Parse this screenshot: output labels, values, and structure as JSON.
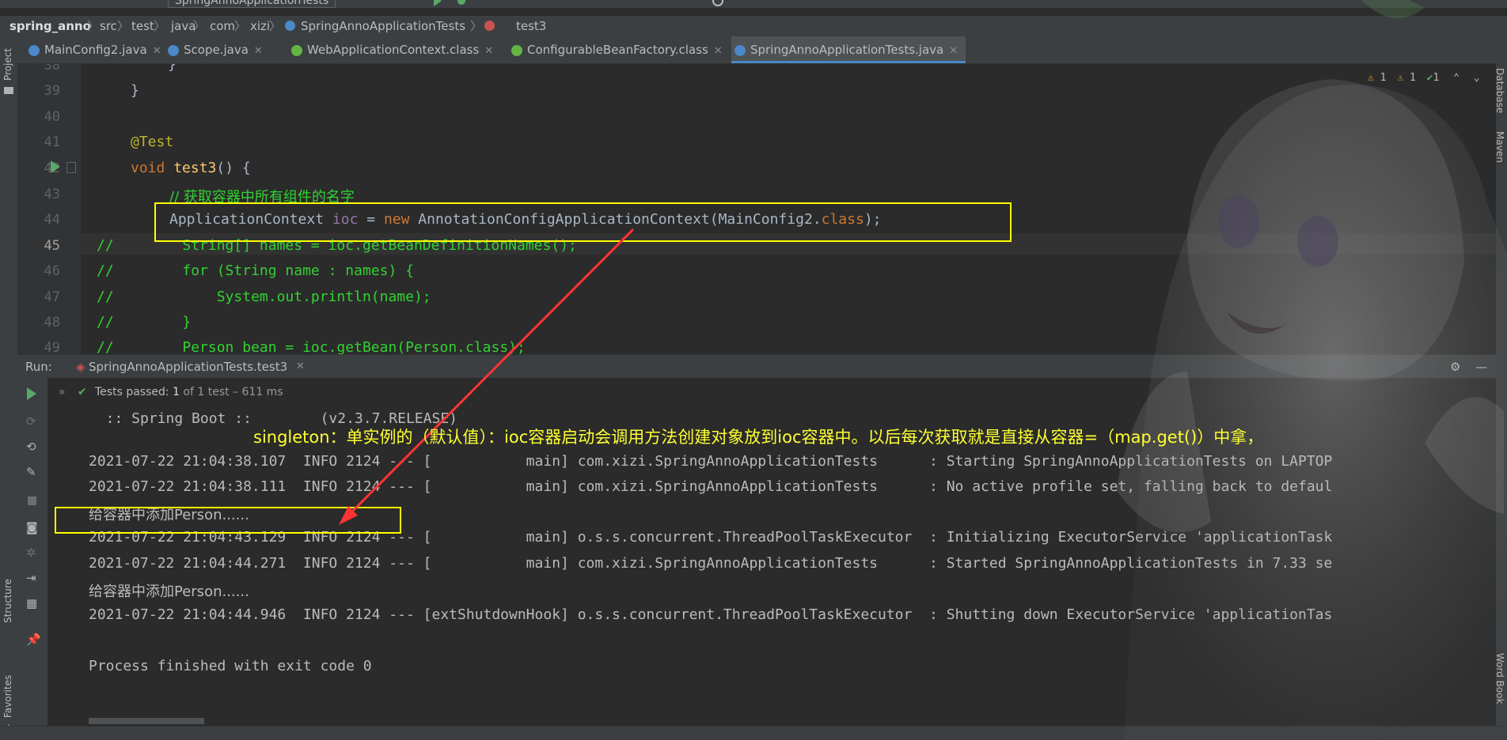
{
  "toolbar": {
    "run_config": "SpringAnnoApplicationTests"
  },
  "breadcrumb": {
    "items": [
      "spring_anno",
      "src",
      "test",
      "java",
      "com",
      "xizi",
      "SpringAnnoApplicationTests",
      "test3"
    ]
  },
  "left_tools": {
    "project": "Project",
    "structure": "Structure",
    "favorites": "Favorites"
  },
  "right_tools": {
    "database": "Database",
    "maven": "Maven",
    "word_book": "Word Book"
  },
  "tabs": [
    {
      "label": "MainConfig2.java",
      "color": "#4a88c7"
    },
    {
      "label": "Scope.java",
      "color": "#4a88c7"
    },
    {
      "label": "WebApplicationContext.class",
      "color": "#62b543"
    },
    {
      "label": "ConfigurableBeanFactory.class",
      "color": "#62b543"
    },
    {
      "label": "SpringAnnoApplicationTests.java",
      "color": "#4a88c7"
    }
  ],
  "inspections": {
    "warn1": "1",
    "warn2": "1",
    "ok": "1"
  },
  "editor": {
    "line_numbers": [
      "38",
      "39",
      "40",
      "41",
      "42",
      "43",
      "44",
      "45",
      "46",
      "47",
      "48",
      "49"
    ],
    "lines": {
      "l38": "}",
      "l39": "}",
      "l41_ann": "@Test",
      "l42_kw": "void",
      "l42_fn": "test3",
      "l42_rest": "() {",
      "l43": "// 获取容器中所有组件的名字",
      "l44_a": "ApplicationContext ",
      "l44_var": "ioc",
      "l44_b": " = ",
      "l44_new": "new",
      "l44_c": " AnnotationConfigApplicationContext(MainConfig2.",
      "l44_class": "class",
      "l44_d": ");",
      "l45": "//        String[] names = ioc.getBeanDefinitionNames();",
      "l46": "//        for (String name : names) {",
      "l47": "//            System.out.println(name);",
      "l48": "//        }",
      "l49": "//        Person bean = ioc.getBean(Person.class);"
    }
  },
  "run": {
    "label": "Run:",
    "tab": "SpringAnnoApplicationTests.test3",
    "status": "Tests passed:",
    "passed": "1",
    "detail": "of 1 test – 611 ms"
  },
  "console": {
    "lines": [
      "  :: Spring Boot ::        (v2.3.7.RELEASE)",
      "",
      "2021-07-22 21:04:38.107  INFO 2124 --- [           main] com.xizi.SpringAnnoApplicationTests      : Starting SpringAnnoApplicationTests on LAPTOP",
      "2021-07-22 21:04:38.111  INFO 2124 --- [           main] com.xizi.SpringAnnoApplicationTests      : No active profile set, falling back to defaul",
      "给容器中添加Person......",
      "2021-07-22 21:04:43.129  INFO 2124 --- [           main] o.s.s.concurrent.ThreadPoolTaskExecutor  : Initializing ExecutorService 'applicationTask",
      "2021-07-22 21:04:44.271  INFO 2124 --- [           main] com.xizi.SpringAnnoApplicationTests      : Started SpringAnnoApplicationTests in 7.33 se",
      "给容器中添加Person......",
      "2021-07-22 21:04:44.946  INFO 2124 --- [extShutdownHook] o.s.s.concurrent.ThreadPoolTaskExecutor  : Shutting down ExecutorService 'applicationTas",
      "",
      "Process finished with exit code 0"
    ]
  },
  "annotation": {
    "note": "singleton：单实例的（默认值）：ioc容器启动会调用方法创建对象放到ioc容器中。以后每次获取就是直接从容器=（map.get()）中拿，",
    "color": "#ffff00",
    "arrow_color": "#ff3333"
  }
}
